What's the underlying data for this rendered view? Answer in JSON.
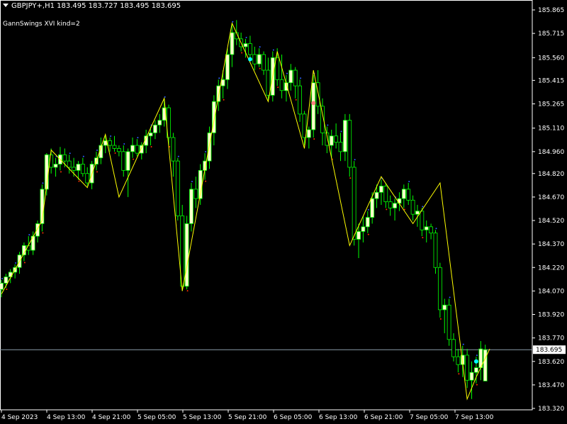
{
  "header": {
    "symbol_line": "GBPJPY+,H1  183.495 183.727 183.495 183.695",
    "indicator": "GannSwings XVI kind=2"
  },
  "colors": {
    "background": "#000000",
    "candle_body": "#ffffcc",
    "wick": "#00ff00",
    "swing_line": "#ffff00",
    "high_dot": "#3060ff",
    "low_dot": "#ff3300",
    "axis": "#ffffff",
    "current_price_line": "#8a9aa8"
  },
  "price_axis": {
    "labels": [
      "185.865",
      "185.715",
      "185.560",
      "185.415",
      "185.265",
      "185.110",
      "184.960",
      "184.820",
      "184.670",
      "184.520",
      "184.370",
      "184.220",
      "184.070",
      "183.920",
      "183.770",
      "183.620",
      "183.470",
      "183.320"
    ],
    "current_price": "183.695"
  },
  "time_axis": {
    "labels": [
      "4 Sep 2023",
      "4 Sep 13:00",
      "4 Sep 21:00",
      "5 Sep 05:00",
      "5 Sep 13:00",
      "5 Sep 21:00",
      "6 Sep 05:00",
      "6 Sep 13:00",
      "6 Sep 21:00",
      "7 Sep 05:00",
      "7 Sep 13:00"
    ]
  },
  "chart_data": {
    "type": "candlestick",
    "x_range": [
      "4 Sep 2023 00:00",
      "7 Sep 2023 21:00"
    ],
    "ylim": [
      183.32,
      185.9
    ],
    "candles": [
      [
        184.08,
        184.14,
        184.03,
        184.12
      ],
      [
        184.12,
        184.18,
        184.09,
        184.16
      ],
      [
        184.16,
        184.21,
        184.12,
        184.19
      ],
      [
        184.19,
        184.24,
        184.15,
        184.22
      ],
      [
        184.22,
        184.32,
        184.18,
        184.3
      ],
      [
        184.3,
        184.38,
        184.26,
        184.36
      ],
      [
        184.36,
        184.42,
        184.3,
        184.33
      ],
      [
        184.33,
        184.45,
        184.3,
        184.42
      ],
      [
        184.42,
        184.52,
        184.38,
        184.5
      ],
      [
        184.5,
        184.75,
        184.45,
        184.72
      ],
      [
        184.72,
        184.95,
        184.68,
        184.94
      ],
      [
        184.94,
        184.98,
        184.82,
        184.86
      ],
      [
        184.86,
        184.92,
        184.8,
        184.88
      ],
      [
        184.88,
        184.99,
        184.84,
        184.94
      ],
      [
        184.94,
        184.98,
        184.86,
        184.9
      ],
      [
        184.9,
        184.94,
        184.82,
        184.86
      ],
      [
        184.86,
        184.92,
        184.8,
        184.84
      ],
      [
        184.84,
        184.9,
        184.78,
        184.88
      ],
      [
        184.88,
        184.92,
        184.8,
        184.82
      ],
      [
        184.82,
        184.86,
        184.74,
        184.76
      ],
      [
        184.76,
        184.9,
        184.72,
        184.88
      ],
      [
        184.88,
        184.96,
        184.84,
        184.92
      ],
      [
        184.92,
        185.05,
        184.88,
        185.0
      ],
      [
        185.0,
        185.06,
        184.95,
        185.03
      ],
      [
        185.03,
        185.05,
        184.96,
        185.0
      ],
      [
        185.0,
        185.06,
        184.96,
        184.98
      ],
      [
        184.98,
        185.0,
        184.93,
        184.96
      ],
      [
        184.96,
        185.0,
        184.8,
        184.84
      ],
      [
        184.84,
        184.98,
        184.67,
        184.96
      ],
      [
        184.96,
        185.05,
        184.92,
        185.0
      ],
      [
        185.0,
        185.04,
        184.93,
        184.95
      ],
      [
        184.95,
        185.02,
        184.91,
        185.0
      ],
      [
        185.0,
        185.1,
        184.95,
        185.06
      ],
      [
        185.06,
        185.12,
        185.0,
        185.08
      ],
      [
        185.08,
        185.16,
        185.04,
        185.13
      ],
      [
        185.13,
        185.2,
        185.08,
        185.16
      ],
      [
        185.16,
        185.3,
        185.12,
        185.24
      ],
      [
        185.24,
        185.26,
        185.0,
        185.05
      ],
      [
        185.05,
        185.08,
        184.8,
        184.9
      ],
      [
        184.9,
        184.92,
        184.52,
        184.55
      ],
      [
        184.55,
        184.62,
        184.07,
        184.1
      ],
      [
        184.1,
        184.55,
        184.08,
        184.5
      ],
      [
        184.5,
        184.76,
        184.45,
        184.72
      ],
      [
        184.72,
        184.8,
        184.6,
        184.66
      ],
      [
        184.66,
        184.88,
        184.62,
        184.84
      ],
      [
        184.84,
        184.95,
        184.78,
        184.9
      ],
      [
        184.9,
        185.12,
        184.85,
        185.08
      ],
      [
        185.08,
        185.32,
        185.0,
        185.28
      ],
      [
        185.28,
        185.42,
        185.22,
        185.38
      ],
      [
        185.38,
        185.48,
        185.3,
        185.42
      ],
      [
        185.42,
        185.62,
        185.36,
        185.58
      ],
      [
        185.58,
        185.78,
        185.5,
        185.72
      ],
      [
        185.72,
        185.8,
        185.64,
        185.68
      ],
      [
        185.68,
        185.72,
        185.6,
        185.63
      ],
      [
        185.63,
        185.68,
        185.56,
        185.65
      ],
      [
        185.65,
        185.7,
        185.55,
        185.58
      ],
      [
        185.58,
        185.63,
        185.48,
        185.52
      ],
      [
        185.52,
        185.62,
        185.5,
        185.58
      ],
      [
        185.58,
        185.6,
        185.45,
        185.48
      ],
      [
        185.48,
        185.56,
        185.28,
        185.32
      ],
      [
        185.32,
        185.6,
        185.28,
        185.56
      ],
      [
        185.56,
        185.62,
        185.38,
        185.42
      ],
      [
        185.42,
        185.58,
        185.3,
        185.35
      ],
      [
        185.35,
        185.45,
        185.28,
        185.4
      ],
      [
        185.4,
        185.52,
        185.35,
        185.48
      ],
      [
        185.48,
        185.5,
        185.3,
        185.38
      ],
      [
        185.38,
        185.42,
        185.15,
        185.2
      ],
      [
        185.2,
        185.22,
        185.0,
        185.05
      ],
      [
        185.05,
        185.12,
        184.98,
        185.1
      ],
      [
        185.1,
        185.45,
        185.05,
        185.4
      ],
      [
        185.4,
        185.48,
        185.2,
        185.25
      ],
      [
        185.25,
        185.3,
        185.0,
        185.08
      ],
      [
        185.08,
        185.12,
        184.95,
        185.0
      ],
      [
        185.0,
        185.1,
        184.92,
        185.06
      ],
      [
        185.06,
        185.14,
        184.98,
        185.02
      ],
      [
        185.02,
        185.08,
        184.9,
        184.96
      ],
      [
        184.96,
        185.2,
        184.9,
        185.16
      ],
      [
        185.16,
        185.2,
        184.8,
        184.86
      ],
      [
        184.86,
        184.9,
        184.36,
        184.4
      ],
      [
        184.4,
        184.5,
        184.28,
        184.45
      ],
      [
        184.45,
        184.55,
        184.38,
        184.48
      ],
      [
        184.48,
        184.58,
        184.44,
        184.54
      ],
      [
        184.54,
        184.7,
        184.5,
        184.66
      ],
      [
        184.66,
        184.75,
        184.6,
        184.7
      ],
      [
        184.7,
        184.78,
        184.62,
        184.74
      ],
      [
        184.74,
        184.76,
        184.6,
        184.64
      ],
      [
        184.64,
        184.68,
        184.55,
        184.6
      ],
      [
        184.6,
        184.66,
        184.52,
        184.63
      ],
      [
        184.63,
        184.7,
        184.58,
        184.66
      ],
      [
        184.66,
        184.75,
        184.6,
        184.72
      ],
      [
        184.72,
        184.76,
        184.62,
        184.65
      ],
      [
        184.65,
        184.68,
        184.52,
        184.56
      ],
      [
        184.56,
        184.62,
        184.48,
        184.58
      ],
      [
        184.58,
        184.6,
        184.42,
        184.46
      ],
      [
        184.46,
        184.52,
        184.38,
        184.48
      ],
      [
        184.48,
        184.5,
        184.4,
        184.44
      ],
      [
        184.44,
        184.46,
        184.18,
        184.22
      ],
      [
        184.22,
        184.25,
        183.9,
        183.95
      ],
      [
        183.95,
        184.02,
        183.8,
        183.98
      ],
      [
        183.98,
        184.02,
        183.72,
        183.76
      ],
      [
        183.76,
        183.8,
        183.62,
        183.65
      ],
      [
        183.65,
        183.7,
        183.55,
        183.6
      ],
      [
        183.6,
        183.72,
        183.52,
        183.66
      ],
      [
        183.66,
        183.7,
        183.45,
        183.5
      ],
      [
        183.5,
        183.62,
        183.38,
        183.55
      ],
      [
        183.55,
        183.65,
        183.48,
        183.58
      ],
      [
        183.58,
        183.75,
        183.5,
        183.7
      ],
      [
        183.495,
        183.727,
        183.495,
        183.695
      ]
    ],
    "swing_points": [
      [
        0,
        184.05
      ],
      [
        9,
        184.52
      ],
      [
        11,
        184.97
      ],
      [
        19,
        184.73
      ],
      [
        23,
        185.07
      ],
      [
        26,
        184.67
      ],
      [
        36,
        185.3
      ],
      [
        40,
        184.07
      ],
      [
        51,
        185.78
      ],
      [
        59,
        185.28
      ],
      [
        61,
        185.6
      ],
      [
        67,
        184.98
      ],
      [
        69,
        185.48
      ],
      [
        77,
        184.36
      ],
      [
        84,
        184.8
      ],
      [
        91,
        184.5
      ],
      [
        97,
        184.76
      ],
      [
        103,
        183.38
      ],
      [
        105,
        183.52
      ],
      [
        108,
        183.7
      ]
    ],
    "markers": [
      {
        "index": 55,
        "price": 185.55,
        "color": "#00ffff"
      },
      {
        "index": 69,
        "price": 185.27,
        "color": "#ff8080"
      },
      {
        "index": 105,
        "price": 183.62,
        "color": "#00ffff"
      }
    ]
  }
}
